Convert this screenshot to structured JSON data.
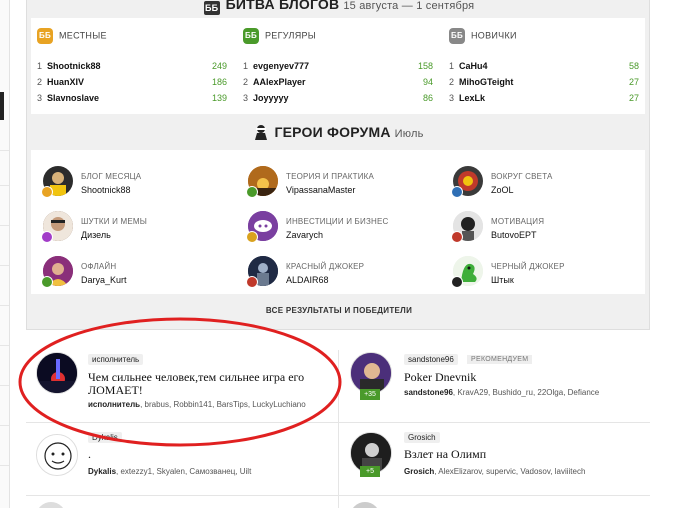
{
  "blog_battle": {
    "icon": "ББ",
    "title": "БИТВА БЛОГОВ",
    "dates": "15 августа — 1 сентября",
    "columns": [
      {
        "label": "МЕСТНЫЕ",
        "badge": "ББ",
        "badge_color": "#e8a323",
        "rows": [
          {
            "rank": "1",
            "name": "Shootnick88",
            "score": "249"
          },
          {
            "rank": "2",
            "name": "HuanXIV",
            "score": "186"
          },
          {
            "rank": "3",
            "name": "Slavnoslave",
            "score": "139"
          }
        ]
      },
      {
        "label": "РЕГУЛЯРЫ",
        "badge": "ББ",
        "badge_color": "#4a9a2a",
        "rows": [
          {
            "rank": "1",
            "name": "evgenyev777",
            "score": "158"
          },
          {
            "rank": "2",
            "name": "AAlexPlayer",
            "score": "94"
          },
          {
            "rank": "3",
            "name": "Joyyyyy",
            "score": "86"
          }
        ]
      },
      {
        "label": "НОВИЧКИ",
        "badge": "ББ",
        "badge_color": "#888888",
        "rows": [
          {
            "rank": "1",
            "name": "CaHu4",
            "score": "58"
          },
          {
            "rank": "2",
            "name": "MihoGTeight",
            "score": "27"
          },
          {
            "rank": "3",
            "name": "LexLk",
            "score": "27"
          }
        ]
      }
    ]
  },
  "forum_heroes": {
    "title": "ГЕРОИ ФОРУМА",
    "month": "Июль",
    "heroes": [
      {
        "category": "БЛОГ МЕСЯЦА",
        "user": "Shootnick88",
        "avatar_color": "#2c2c2c",
        "mini_color": "#e8a323"
      },
      {
        "category": "ТЕОРИЯ И ПРАКТИКА",
        "user": "VipassanaMaster",
        "avatar_color": "#b06a1c",
        "mini_color": "#4a9a2a"
      },
      {
        "category": "ВОКРУГ СВЕТА",
        "user": "ZoOL",
        "avatar_color": "#3a3a3a",
        "mini_color": "#2f6fb5"
      },
      {
        "category": "ШУТКИ И МЕМЫ",
        "user": "Дизель",
        "avatar_color": "#6b4a33",
        "mini_color": "#a23cc8"
      },
      {
        "category": "ИНВЕСТИЦИИ И БИЗНЕС",
        "user": "Zavarych",
        "avatar_color": "#7a3fa0",
        "mini_color": "#d9a21f"
      },
      {
        "category": "МОТИВАЦИЯ",
        "user": "ButovoEPT",
        "avatar_color": "#d9d9d9",
        "mini_color": "#c0392b"
      },
      {
        "category": "ОФЛАЙН",
        "user": "Darya_Kurt",
        "avatar_color": "#8a2f7a",
        "mini_color": "#4a9a2a"
      },
      {
        "category": "КРАСНЫЙ ДЖОКЕР",
        "user": "ALDAIR68",
        "avatar_color": "#1f2a44",
        "mini_color": "#c0392b"
      },
      {
        "category": "ЧЕРНЫЙ ДЖОКЕР",
        "user": "Штык",
        "avatar_color": "#e9f3e4",
        "mini_color": "#222222"
      }
    ],
    "results_link": "ВСЕ РЕЗУЛЬТАТЫ И ПОБЕДИТЕЛИ"
  },
  "posts": [
    {
      "tag": "исполнитель",
      "title": "Чем сильнее человек,тем сильнее игра его ЛОМАЕТ!",
      "author": "исполнитель",
      "others": ", brabus, Robbin141, BarsTips, LuckyLuchiano"
    },
    {
      "tag": "sandstone96",
      "recommended": "РЕКОМЕНДУЕМ",
      "title": "Poker Dnevnik",
      "author": "sandstone96",
      "others": ", KravA29, Bushido_ru, 22Olga, Defiance",
      "plus": "+35"
    },
    {
      "tag": "Dykalis",
      "title": ".",
      "author": "Dykalis",
      "others": ", extezzy1, Skyalen, Самозванец, Uilt"
    },
    {
      "tag": "Grosich",
      "title": "Взлет на Олимп",
      "author": "Grosich",
      "others": ", AlexElizarov, supervic, Vadosov, laviiitech",
      "plus": "+5"
    }
  ],
  "colors": {
    "accent_green": "#4a9a2a",
    "highlight_oval": "#e02020"
  }
}
